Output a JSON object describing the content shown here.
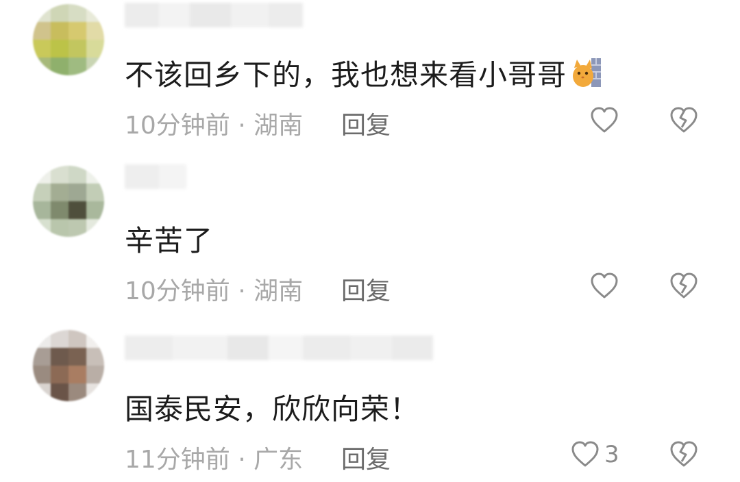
{
  "comments": [
    {
      "text": "不该回乡下的，我也想来看小哥哥",
      "emoji": "cat-peeking-emoji",
      "time": "10分钟前",
      "location": "湖南",
      "reply_label": "回复",
      "like_count": ""
    },
    {
      "text": "辛苦了",
      "time": "10分钟前",
      "location": "湖南",
      "reply_label": "回复",
      "like_count": ""
    },
    {
      "text": "国泰民安，欣欣向荣！",
      "time": "11分钟前",
      "location": "广东",
      "reply_label": "回复",
      "like_count": "3"
    }
  ],
  "meta_separator": " · ",
  "icons": {
    "like": "heart-outline-icon",
    "dislike": "broken-heart-icon"
  },
  "colors": {
    "text": "#1c1c1c",
    "meta": "#a8a8a8",
    "reply": "#6b6b6b",
    "icon": "#8a8a8a"
  }
}
